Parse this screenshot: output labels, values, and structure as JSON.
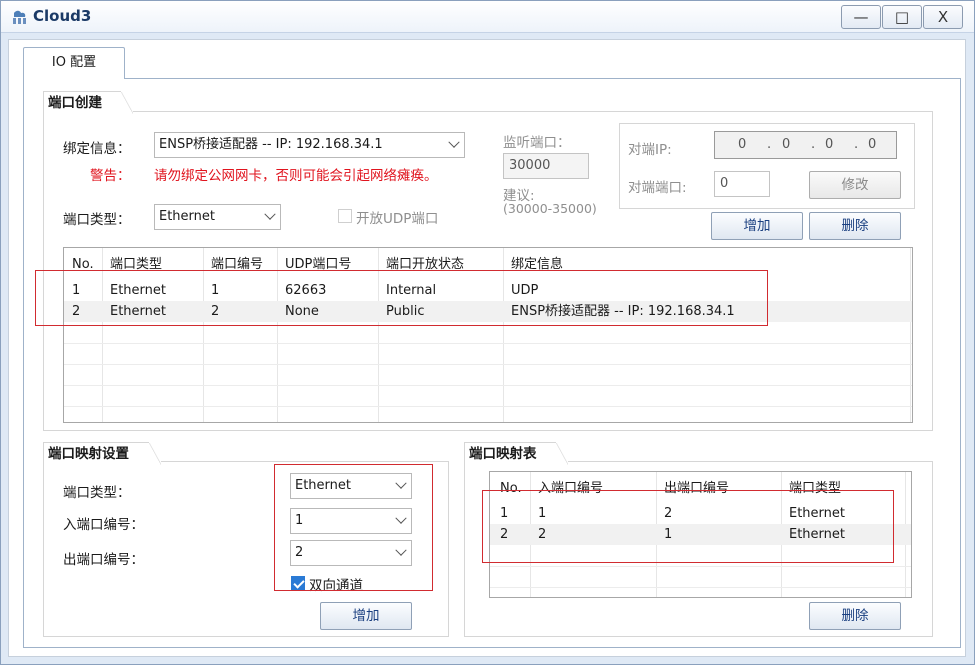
{
  "window": {
    "title": "Cloud3",
    "min_label": "—",
    "max_label": "□",
    "close_label": "X"
  },
  "tab": {
    "label": "IO 配置"
  },
  "port_create": {
    "legend": "端口创建",
    "bind_label": "绑定信息：",
    "bind_value": "ENSP桥接适配器 -- IP: 192.168.34.1",
    "warn_label": "警告：",
    "warn_text": "请勿绑定公网网卡，否则可能会引起网络瘫痪。",
    "type_label": "端口类型：",
    "type_value": "Ethernet",
    "udp_label": "开放UDP端口",
    "udp_checked": false,
    "listen_label": "监听端口：",
    "listen_value": "30000",
    "suggest_label": "建议:",
    "suggest_range": "(30000-35000)",
    "peer_ip_label": "对端IP:",
    "peer_ip": [
      "0",
      "0",
      "0",
      "0"
    ],
    "peer_ip_dot": ".",
    "peer_port_label": "对端端口:",
    "peer_port_value": "0",
    "modify_button": "修改",
    "add_button": "增加",
    "delete_button": "删除",
    "table": {
      "columns": [
        "No.",
        "端口类型",
        "端口编号",
        "UDP端口号",
        "端口开放状态",
        "绑定信息"
      ],
      "rows": [
        [
          "1",
          "Ethernet",
          "1",
          "62663",
          "Internal",
          "UDP"
        ],
        [
          "2",
          "Ethernet",
          "2",
          "None",
          "Public",
          "ENSP桥接适配器 -- IP: 192.168.34.1"
        ]
      ]
    }
  },
  "port_mapping_settings": {
    "legend": "端口映射设置",
    "type_label": "端口类型：",
    "type_value": "Ethernet",
    "in_label": "入端口编号：",
    "in_value": "1",
    "out_label": "出端口编号：",
    "out_value": "2",
    "bidirectional_label": "双向通道",
    "bidirectional_checked": true,
    "add_button": "增加"
  },
  "port_mapping_table": {
    "legend": "端口映射表",
    "columns": [
      "No.",
      "入端口编号",
      "出端口编号",
      "端口类型"
    ],
    "rows": [
      [
        "1",
        "1",
        "2",
        "Ethernet"
      ],
      [
        "2",
        "2",
        "1",
        "Ethernet"
      ]
    ],
    "delete_button": "删除"
  },
  "colors": {
    "warning": "#e0141e",
    "highlight_box": "#d12b30",
    "checkbox_on": "#2a7ad5",
    "button_text": "#1a3f80"
  }
}
